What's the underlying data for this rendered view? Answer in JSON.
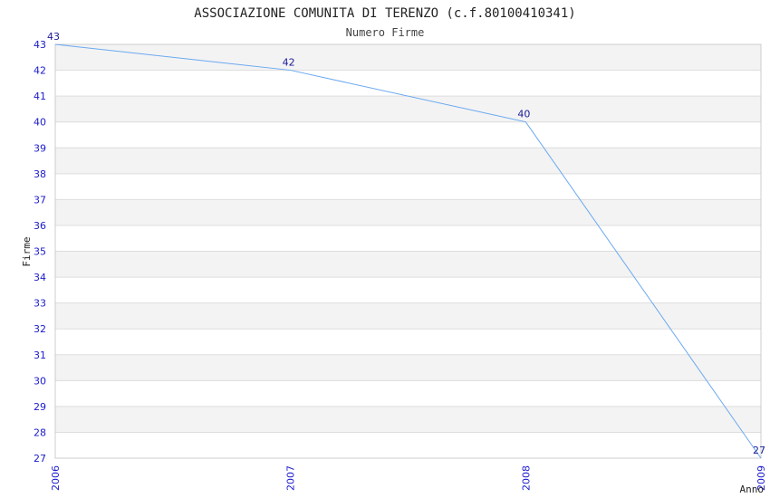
{
  "chart_data": {
    "type": "line",
    "title": "ASSOCIAZIONE COMUNITA DI TERENZO (c.f.80100410341)",
    "subtitle": "Numero Firme",
    "xlabel": "Anno",
    "ylabel": "Firme",
    "x": [
      "2006",
      "2007",
      "2008",
      "2009"
    ],
    "series": [
      {
        "values": [
          43,
          42,
          40,
          27
        ]
      }
    ],
    "ylim": [
      27,
      43
    ],
    "yticks": [
      27,
      28,
      29,
      30,
      31,
      32,
      33,
      34,
      35,
      36,
      37,
      38,
      39,
      40,
      41,
      42,
      43
    ],
    "grid": true,
    "colors": {
      "line": "#6aa9f0",
      "band_alt": "#f3f3f3",
      "band": "#ffffff",
      "tick_text": "#1a1acc",
      "grid": "#dddddd"
    }
  }
}
